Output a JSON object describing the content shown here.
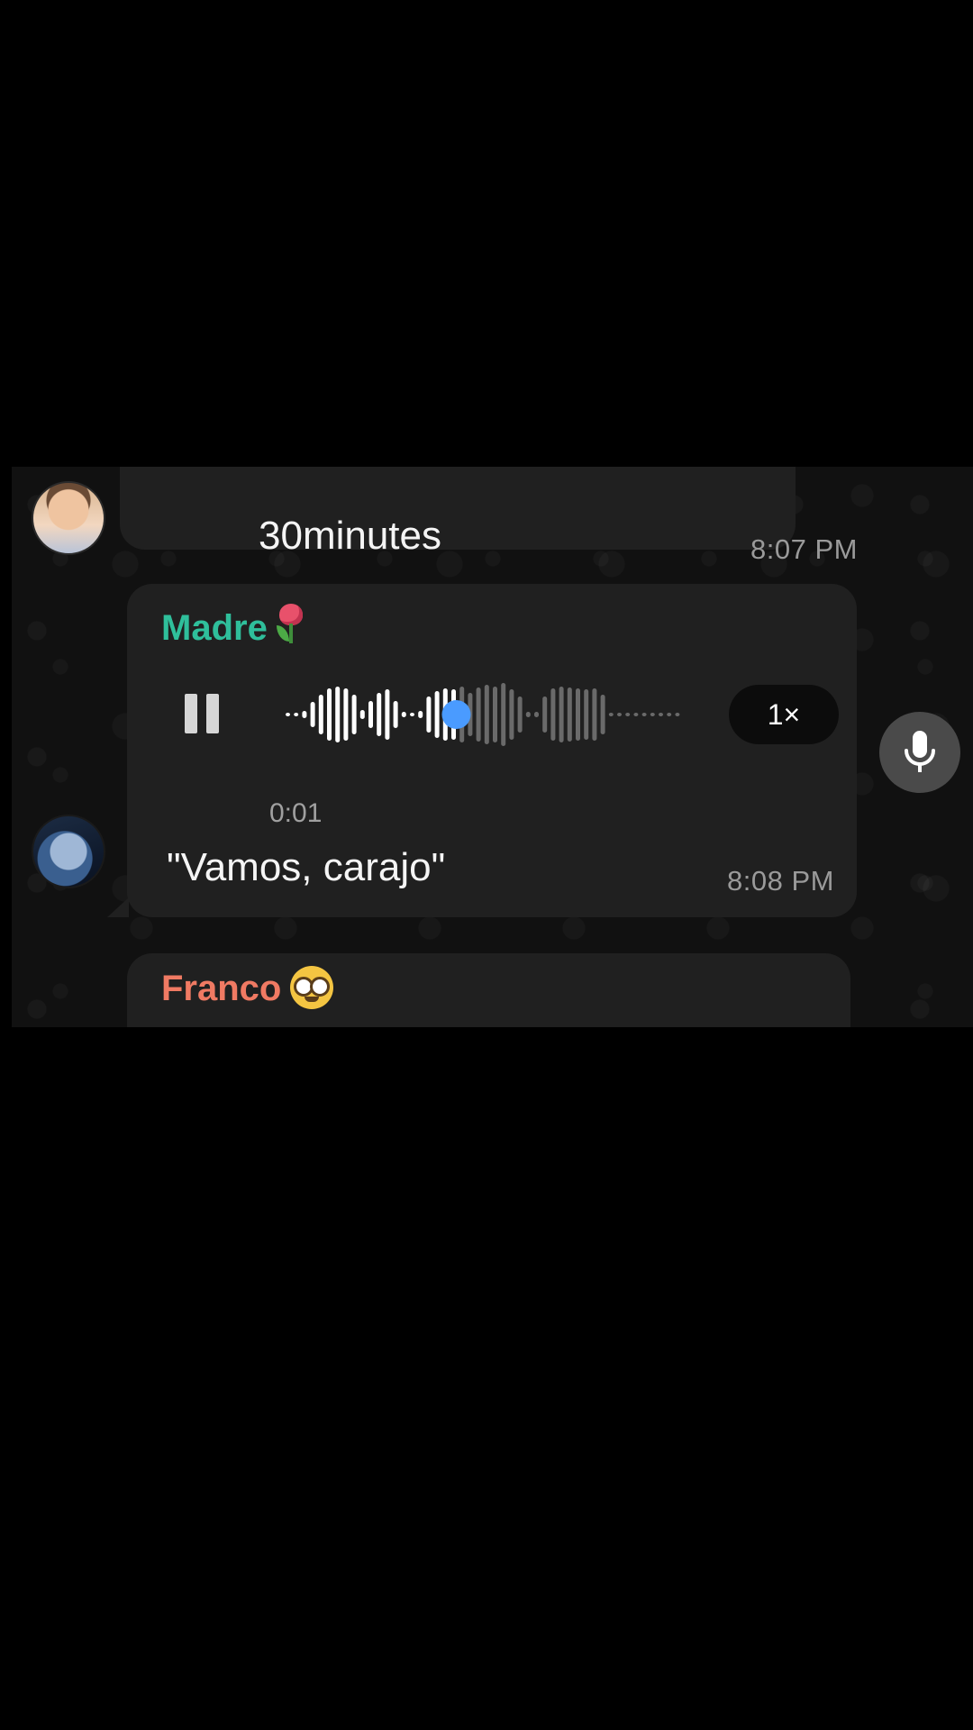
{
  "messages": [
    {
      "text": "30minutes",
      "time": "8:07 PM"
    },
    {
      "sender": "Madre",
      "sender_emoji": "tulip",
      "type": "voice",
      "duration": "0:01",
      "speed": "1×",
      "playback_progress": 0.45,
      "state": "playing",
      "caption": "\"Vamos, carajo\"",
      "time": "8:08 PM"
    },
    {
      "sender": "Franco",
      "sender_emoji": "nerd-face"
    }
  ],
  "colors": {
    "madre_name": "#2fbf9b",
    "franco_name": "#f07a63",
    "waveform_played": "#ffffff",
    "waveform_unplayed": "#6a6a6a",
    "scrubber": "#4a9bff",
    "bubble": "#202020",
    "mic_button": "#4a4a4a"
  },
  "icons": {
    "pause": "pause-icon",
    "mic": "microphone-icon"
  }
}
